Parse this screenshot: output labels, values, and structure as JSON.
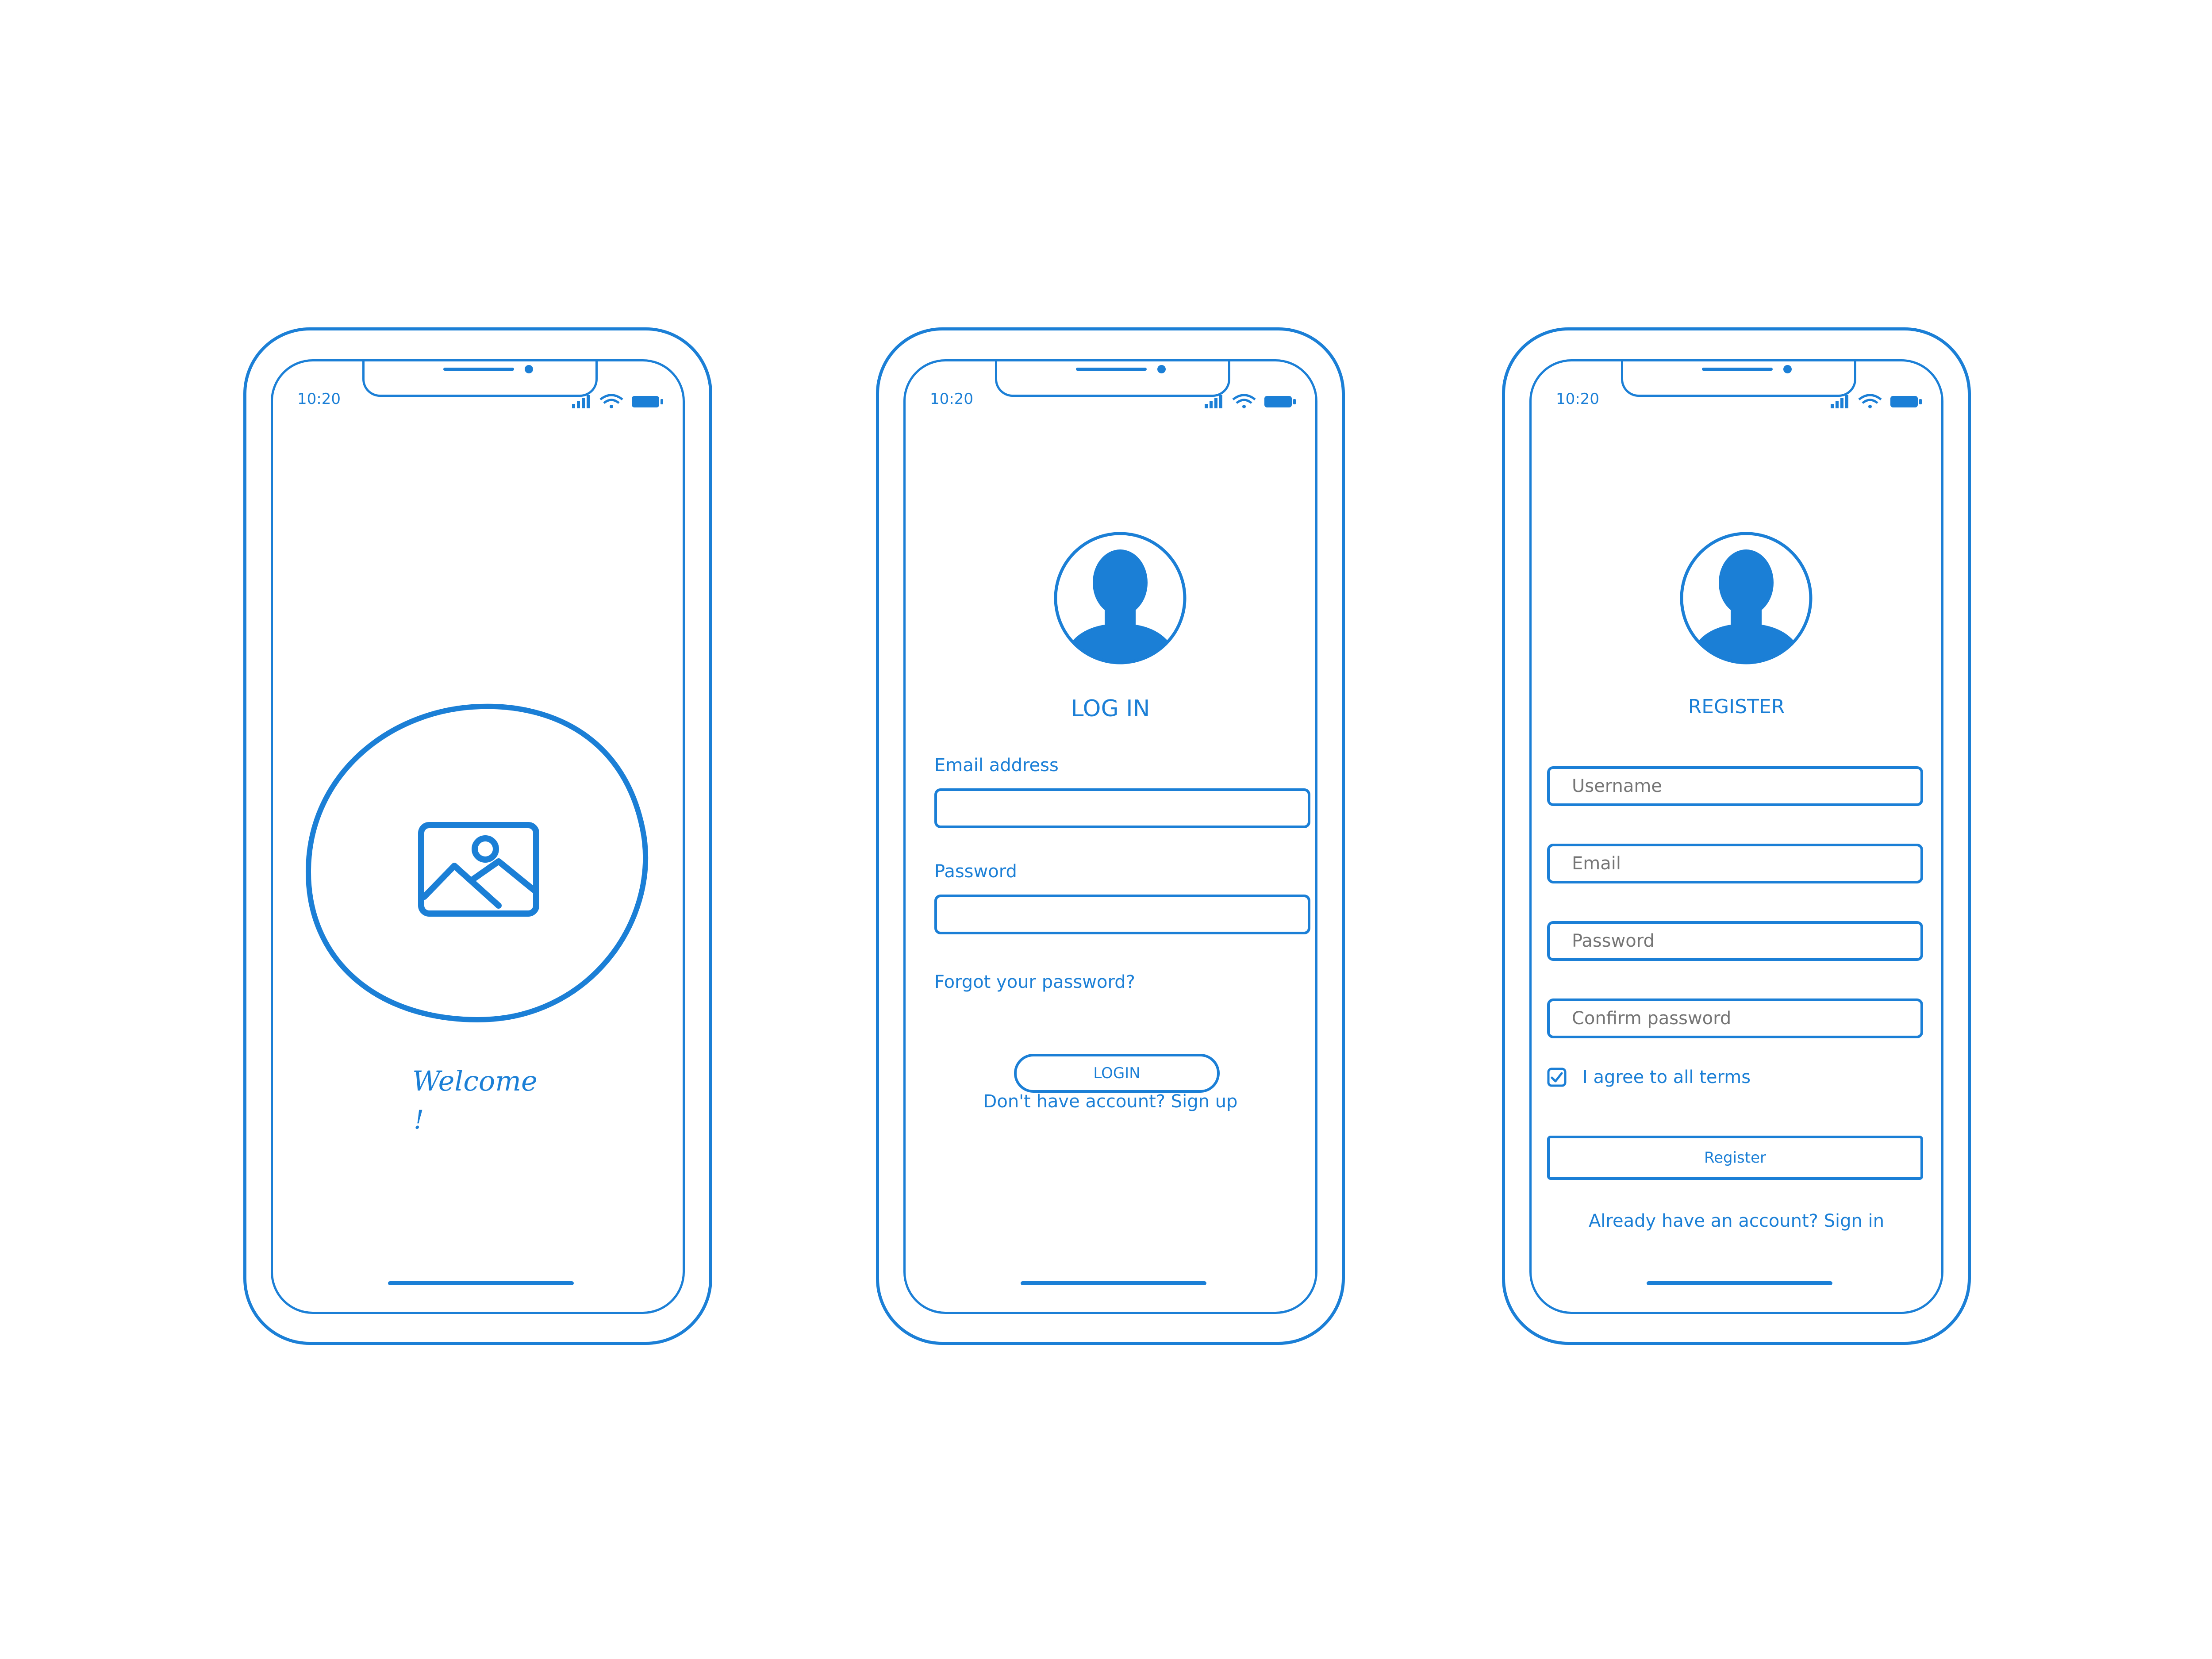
{
  "status_bar": {
    "time": "10:20"
  },
  "welcome_screen": {
    "title": "Welcome",
    "title_mark": "!",
    "image_icon": "image-placeholder-icon"
  },
  "login_screen": {
    "title": "LOG IN",
    "avatar_icon": "user-avatar-icon",
    "email_label": "Email address",
    "email_value": "",
    "password_label": "Password",
    "password_value": "",
    "forgot_link": "Forgot your password?",
    "login_button": "LOGIN",
    "signup_link": "Don't have account? Sign up"
  },
  "register_screen": {
    "title": "REGISTER",
    "avatar_icon": "user-avatar-icon",
    "username_placeholder": "Username",
    "email_placeholder": "Email",
    "password_placeholder": "Password",
    "confirm_placeholder": "Confirm password",
    "terms_label": "I agree to all terms",
    "terms_checked": true,
    "register_button": "Register",
    "signin_link": "Already have an account? Sign in"
  },
  "colors": {
    "accent": "#1b7fd6",
    "background": "#ffffff"
  }
}
